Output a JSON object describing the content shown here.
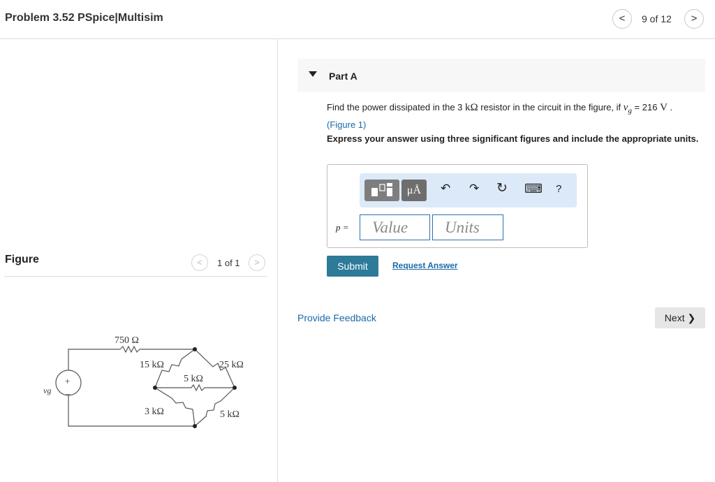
{
  "header": {
    "title": "Problem 3.52 PSpice|Multisim",
    "page_counter": "9 of 12",
    "prev_symbol": "<",
    "next_symbol": ">"
  },
  "figure": {
    "label": "Figure",
    "counter": "1 of 1",
    "prev_symbol": "<",
    "next_symbol": ">",
    "circuit": {
      "r_series": "750 Ω",
      "r_top_left": "15 kΩ",
      "r_top_right": "25 kΩ",
      "r_middle": "5 kΩ",
      "r_bottom_left": "3 kΩ",
      "r_bottom_right": "5 kΩ",
      "source": "vg",
      "source_plus": "+",
      "source_minus": "−"
    }
  },
  "part": {
    "caret_icon": "caret-down-icon",
    "title": "Part A",
    "question_pre": "Find the power dissipated in the 3 ",
    "question_unit": "kΩ",
    "question_mid": " resistor in the circuit in the figure, if ",
    "question_var": "v",
    "question_sub": "g",
    "question_eq": " = 216 ",
    "question_v": "V",
    "question_dot": " .",
    "figure_link": "(Figure 1)",
    "instruction": "Express your answer using three significant figures and include the appropriate units."
  },
  "toolbar": {
    "units_icon": "μÅ",
    "undo_icon": "↶",
    "redo_icon": "↷",
    "reset_icon": "↻",
    "keyboard_icon": "⌨",
    "help_icon": "?"
  },
  "answer": {
    "label": "p =",
    "value_placeholder": "Value",
    "units_placeholder": "Units"
  },
  "actions": {
    "submit": "Submit",
    "request_answer": "Request Answer",
    "provide_feedback": "Provide Feedback",
    "next": "Next ❯"
  }
}
